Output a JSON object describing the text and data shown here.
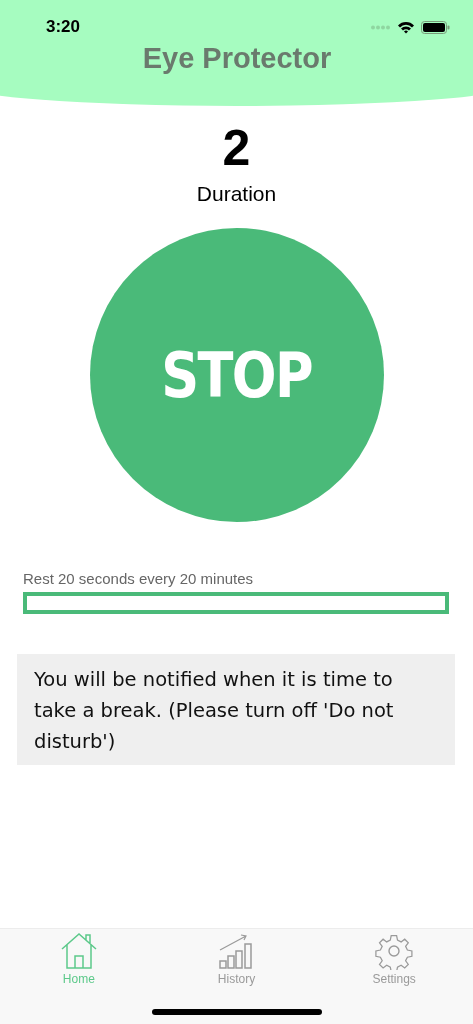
{
  "status_bar": {
    "time": "3:20"
  },
  "header": {
    "title": "Eye Protector"
  },
  "counter": {
    "value": "2",
    "label": "Duration"
  },
  "stop_button": {
    "label": "STOP"
  },
  "rest": {
    "label": "Rest 20 seconds every 20 minutes",
    "level": 0
  },
  "notice": "You will be notified when it is time to take a break. (Please turn off 'Do not disturb')",
  "tabs": [
    {
      "kind": "home",
      "label": "Home",
      "selected": true
    },
    {
      "kind": "history",
      "label": "History",
      "selected": false
    },
    {
      "kind": "settings",
      "label": "Settings",
      "selected": false
    }
  ]
}
